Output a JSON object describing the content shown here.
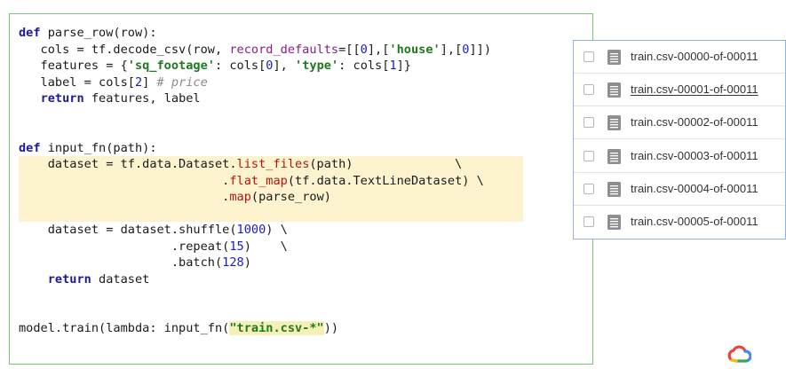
{
  "code": {
    "lines": [
      {
        "parts": [
          {
            "t": "def",
            "c": "kw"
          },
          {
            "t": " parse_row(row):"
          }
        ]
      },
      {
        "parts": [
          {
            "t": "   cols = tf.decode_csv(row, "
          },
          {
            "t": "record_defaults",
            "c": "param"
          },
          {
            "t": "=[["
          },
          {
            "t": "0",
            "c": "num"
          },
          {
            "t": "],["
          },
          {
            "t": "'house'",
            "c": "str"
          },
          {
            "t": "],["
          },
          {
            "t": "0",
            "c": "num"
          },
          {
            "t": "]])"
          }
        ]
      },
      {
        "parts": [
          {
            "t": "   features = {"
          },
          {
            "t": "'sq_footage'",
            "c": "str"
          },
          {
            "t": ": cols["
          },
          {
            "t": "0",
            "c": "num"
          },
          {
            "t": "], "
          },
          {
            "t": "'type'",
            "c": "str"
          },
          {
            "t": ": cols["
          },
          {
            "t": "1",
            "c": "num"
          },
          {
            "t": "]}"
          }
        ]
      },
      {
        "parts": [
          {
            "t": "   label = cols["
          },
          {
            "t": "2",
            "c": "num"
          },
          {
            "t": "] "
          },
          {
            "t": "# price",
            "c": "comment"
          }
        ]
      },
      {
        "parts": [
          {
            "t": "   "
          },
          {
            "t": "return",
            "c": "kw"
          },
          {
            "t": " features, label"
          }
        ]
      },
      {
        "parts": []
      },
      {
        "parts": []
      },
      {
        "parts": [
          {
            "t": "def",
            "c": "kw"
          },
          {
            "t": " input_fn(path):"
          }
        ]
      },
      {
        "parts": [
          {
            "t": "    dataset = tf.data.Dataset."
          },
          {
            "t": "list_files",
            "c": "fn"
          },
          {
            "t": "(path)              \\"
          }
        ]
      },
      {
        "parts": [
          {
            "t": "                            ."
          },
          {
            "t": "flat_map",
            "c": "fn"
          },
          {
            "t": "(tf.data.TextLineDataset) \\"
          }
        ]
      },
      {
        "parts": [
          {
            "t": "                            ."
          },
          {
            "t": "map",
            "c": "fn"
          },
          {
            "t": "(parse_row)"
          }
        ]
      },
      {
        "parts": []
      },
      {
        "parts": [
          {
            "t": "    dataset = dataset.shuffle("
          },
          {
            "t": "1000",
            "c": "num"
          },
          {
            "t": ") \\"
          }
        ]
      },
      {
        "parts": [
          {
            "t": "                     .repeat("
          },
          {
            "t": "15",
            "c": "num"
          },
          {
            "t": ")    \\"
          }
        ]
      },
      {
        "parts": [
          {
            "t": "                     .batch("
          },
          {
            "t": "128",
            "c": "num"
          },
          {
            "t": ")"
          }
        ]
      },
      {
        "parts": [
          {
            "t": "    "
          },
          {
            "t": "return",
            "c": "kw"
          },
          {
            "t": " dataset"
          }
        ]
      },
      {
        "parts": []
      },
      {
        "parts": []
      },
      {
        "parts": [
          {
            "t": "model.train(lambda: input_fn("
          },
          {
            "t": "\"train.csv-*\"",
            "c": "str hl-str"
          },
          {
            "t": "))"
          }
        ]
      }
    ]
  },
  "files": [
    {
      "name": "train.csv-00000-of-00011",
      "underline": false
    },
    {
      "name": "train.csv-00001-of-00011",
      "underline": true
    },
    {
      "name": "train.csv-00002-of-00011",
      "underline": false
    },
    {
      "name": "train.csv-00003-of-00011",
      "underline": false
    },
    {
      "name": "train.csv-00004-of-00011",
      "underline": false
    },
    {
      "name": "train.csv-00005-of-00011",
      "underline": false
    }
  ],
  "colors": {
    "code_border": "#7cc47c",
    "file_panel_border": "#8fb0e0",
    "highlight": "#fdf3cf"
  },
  "icons": {
    "file_icon": "document-icon",
    "checkbox": "checkbox-icon",
    "logo": "google-cloud-logo-icon"
  }
}
